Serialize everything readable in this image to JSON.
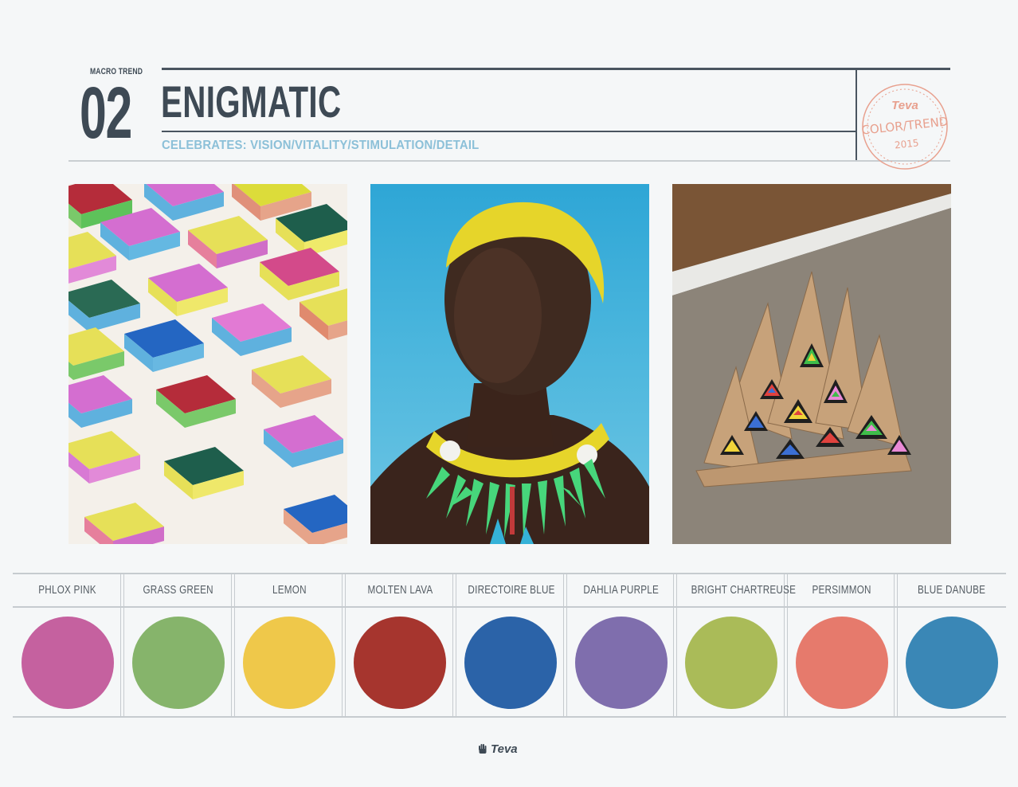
{
  "header": {
    "macro_label": "MACRO TREND",
    "trend_number": "02",
    "trend_title": "ENIGMATIC",
    "celebrates": "CELEBRATES: VISION/VITALITY/STIMULATION/DETAIL"
  },
  "stamp": {
    "brand": "Teva",
    "line1": "COLOR/TREND",
    "year": "2015",
    "color": "#e8a08e"
  },
  "photos": [
    {
      "subject": "colorful kitchen sponges"
    },
    {
      "subject": "portrait with yellow hair and green spiked necklace"
    },
    {
      "subject": "split wood logs with painted rainbow triangles"
    }
  ],
  "palette": {
    "swatches": [
      {
        "name": "PHLOX PINK",
        "color": "#c5619f"
      },
      {
        "name": "GRASS GREEN",
        "color": "#86b46b"
      },
      {
        "name": "LEMON",
        "color": "#efc84a"
      },
      {
        "name": "MOLTEN LAVA",
        "color": "#a6352e"
      },
      {
        "name": "DIRECTOIRE BLUE",
        "color": "#2b63a8"
      },
      {
        "name": "DAHLIA PURPLE",
        "color": "#7f6ead"
      },
      {
        "name": "BRIGHT CHARTREUSE",
        "color": "#aabb58"
      },
      {
        "name": "PERSIMMON",
        "color": "#e67a6c"
      },
      {
        "name": "BLUE DANUBE",
        "color": "#3a87b6"
      }
    ]
  },
  "footer": {
    "brand": "Teva"
  }
}
